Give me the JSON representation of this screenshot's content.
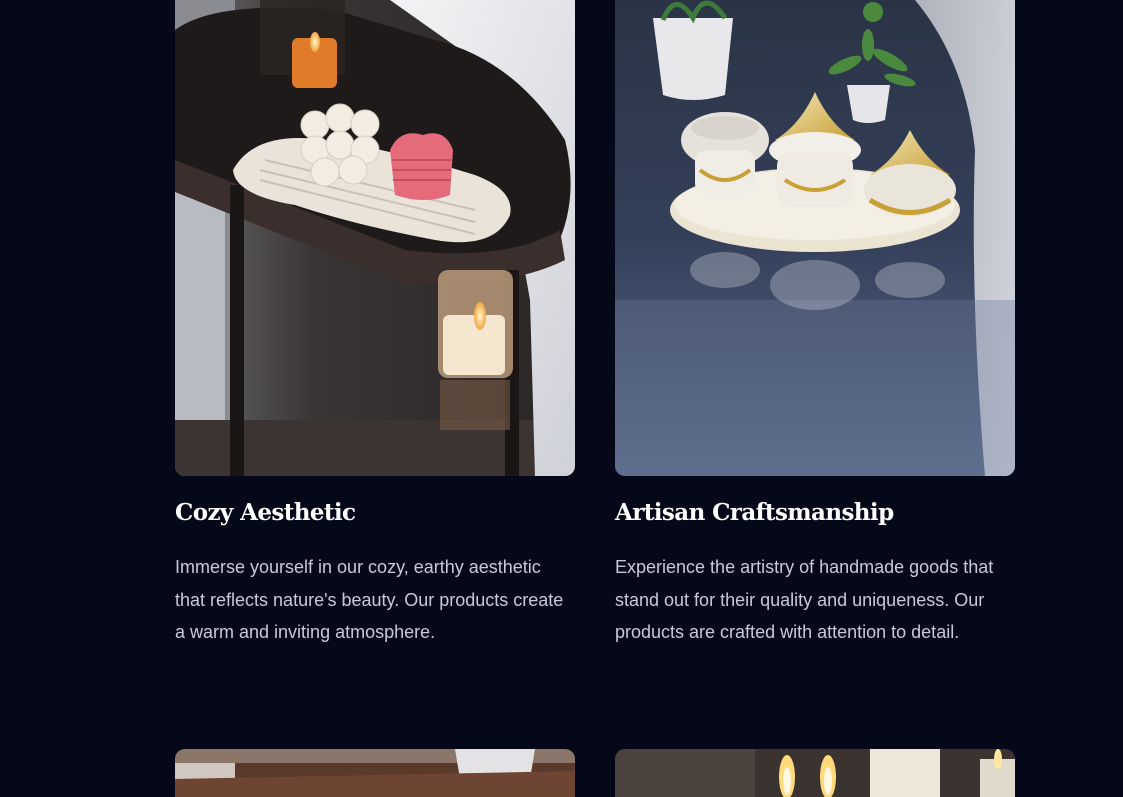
{
  "features": [
    {
      "title": "Cozy Aesthetic",
      "description": "Immerse yourself in our cozy, earthy aesthetic that reflects nature's beauty. Our products create a warm and inviting atmosphere.",
      "image_alt": "Bubble candle and heart candle on a wavy tray atop a dark side table with tealight candles"
    },
    {
      "title": "Artisan Craftsmanship",
      "description": "Experience the artistry of handmade goods that stand out for their quality and uniqueness. Our products are crafted with attention to detail.",
      "image_alt": "Gold and white ceramic jars on an oval tray with potted plants on a glossy dark table"
    }
  ],
  "next_row": [
    {
      "image_alt": "Wooden surface with white curtain"
    },
    {
      "image_alt": "Lit candles"
    }
  ],
  "colors": {
    "background": "#050819",
    "title": "#ffffff",
    "description": "#c7cad6"
  }
}
